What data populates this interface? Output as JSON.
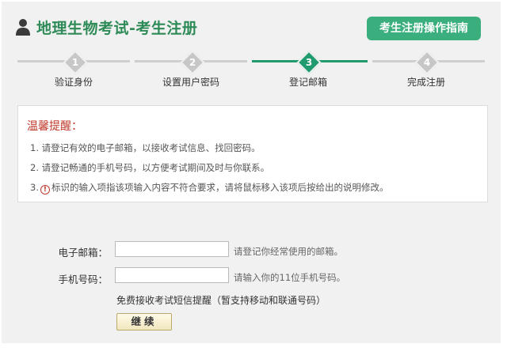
{
  "header": {
    "title": "地理生物考试-考生注册",
    "guide_button": "考生注册操作指南"
  },
  "steps": [
    {
      "number": "1",
      "label": "验证身份",
      "active": false
    },
    {
      "number": "2",
      "label": "设置用户密码",
      "active": false
    },
    {
      "number": "3",
      "label": "登记邮箱",
      "active": true
    },
    {
      "number": "4",
      "label": "完成注册",
      "active": false
    }
  ],
  "notice": {
    "title": "温馨提醒：",
    "items": [
      "1. 请登记有效的电子邮箱，以接收考试信息、找回密码。",
      "2. 请登记畅通的手机号码，以方便考试期间及时与你联系。",
      "3.",
      "标识的输入项指该项输入内容不符合要求，请将鼠标移入该项后按给出的说明修改。"
    ]
  },
  "form": {
    "email_label": "电子邮箱：",
    "email_value": "",
    "email_hint": "请登记你经常使用的邮箱。",
    "phone_label": "手机号码：",
    "phone_value": "",
    "phone_hint": "请输入你的11位手机号码。",
    "sms_note": "免费接收考试短信提醒（暂支持移动和联通号码）",
    "continue_button": "继续"
  },
  "colors": {
    "accent_green": "#1f9b6d",
    "title_green": "#2e8b57",
    "button_green": "#3aae7c",
    "warning_red": "#c0392b"
  },
  "icons": {
    "header": "user-icon",
    "warning": "exclamation-circle-icon"
  }
}
